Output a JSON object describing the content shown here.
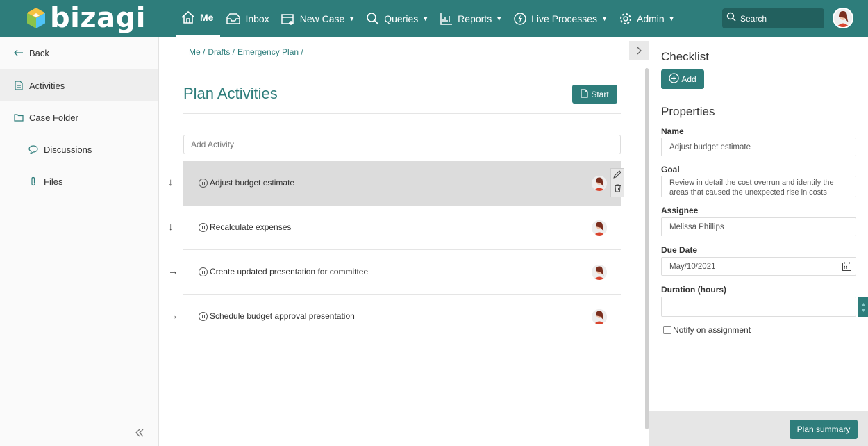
{
  "app": {
    "logo_text": "bizagi"
  },
  "nav": {
    "items": [
      {
        "label": "Me",
        "icon": "home-icon",
        "active": true
      },
      {
        "label": "Inbox",
        "icon": "inbox-icon"
      },
      {
        "label": "New Case",
        "icon": "new-case-icon",
        "dropdown": true
      },
      {
        "label": "Queries",
        "icon": "search-icon",
        "dropdown": true
      },
      {
        "label": "Reports",
        "icon": "chart-icon",
        "dropdown": true
      },
      {
        "label": "Live Processes",
        "icon": "lightning-icon",
        "dropdown": true
      },
      {
        "label": "Admin",
        "icon": "gear-icon",
        "dropdown": true
      }
    ],
    "search_placeholder": "Search"
  },
  "sidebar": {
    "items": [
      {
        "label": "Back",
        "icon": "arrow-left-icon"
      },
      {
        "label": "Activities",
        "icon": "document-icon",
        "active": true
      },
      {
        "label": "Case Folder",
        "icon": "folder-icon"
      },
      {
        "label": "Discussions",
        "icon": "chat-icon"
      },
      {
        "label": "Files",
        "icon": "paperclip-icon"
      }
    ]
  },
  "main": {
    "breadcrumb": [
      "Me /",
      "Drafts /",
      "Emergency Plan /"
    ],
    "title": "Plan Activities",
    "start_label": "Start",
    "add_activity_placeholder": "Add Activity",
    "activities": [
      {
        "name": "Adjust budget estimate",
        "arrow": "↓",
        "selected": true
      },
      {
        "name": "Recalculate expenses",
        "arrow": "↓"
      },
      {
        "name": "Create updated presentation for committee",
        "arrow": "→"
      },
      {
        "name": "Schedule budget approval presentation",
        "arrow": "→"
      }
    ]
  },
  "panel": {
    "checklist_title": "Checklist",
    "add_label": "Add",
    "properties_title": "Properties",
    "fields": {
      "name_label": "Name",
      "name_value": "Adjust budget estimate",
      "goal_label": "Goal",
      "goal_value": "Review in detail the cost overrun and identify the areas that caused the unexpected rise in costs",
      "assignee_label": "Assignee",
      "assignee_value": "Melissa Phillips",
      "due_label": "Due Date",
      "due_value": "May/10/2021",
      "duration_label": "Duration (hours)",
      "duration_value": "",
      "notify_label": "Notify on assignment"
    },
    "summary_label": "Plan summary"
  },
  "colors": {
    "brand": "#2e7d7b",
    "selected_row": "#dcdcdc"
  }
}
